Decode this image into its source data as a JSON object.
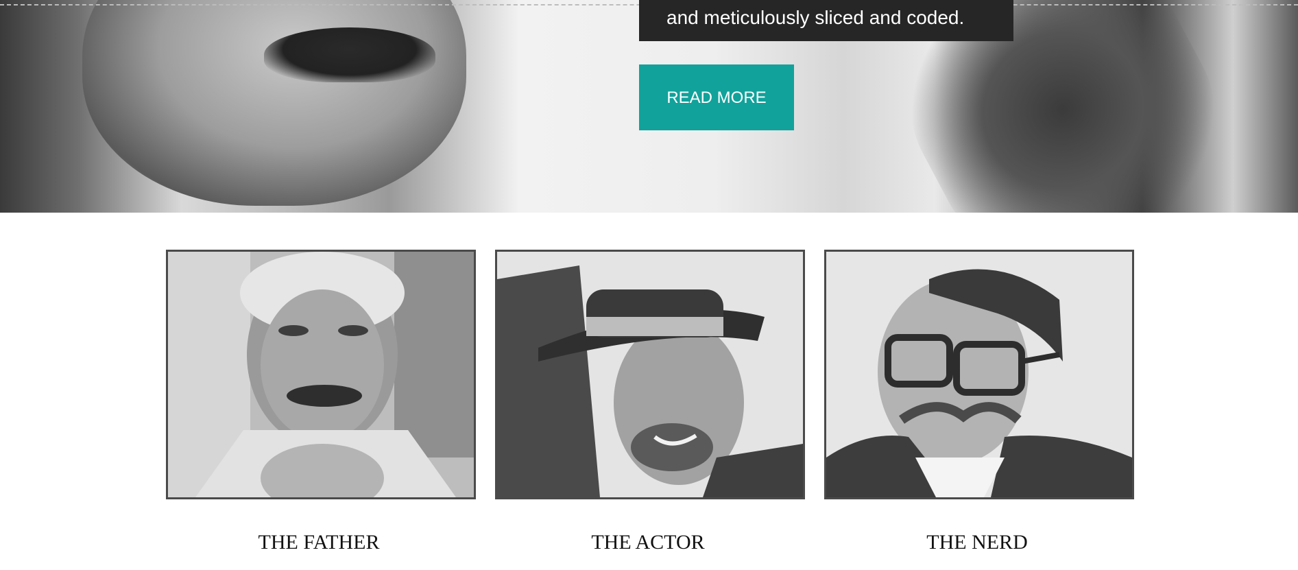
{
  "hero": {
    "caption": "and meticulously sliced and coded.",
    "button_label": "READ MORE",
    "button_color": "#11a29b",
    "caption_background": "#262626"
  },
  "cards": [
    {
      "title": "THE FATHER",
      "image_icon": "portrait-father-icon"
    },
    {
      "title": "THE ACTOR",
      "image_icon": "portrait-actor-icon"
    },
    {
      "title": "THE NERD",
      "image_icon": "portrait-nerd-icon"
    }
  ]
}
